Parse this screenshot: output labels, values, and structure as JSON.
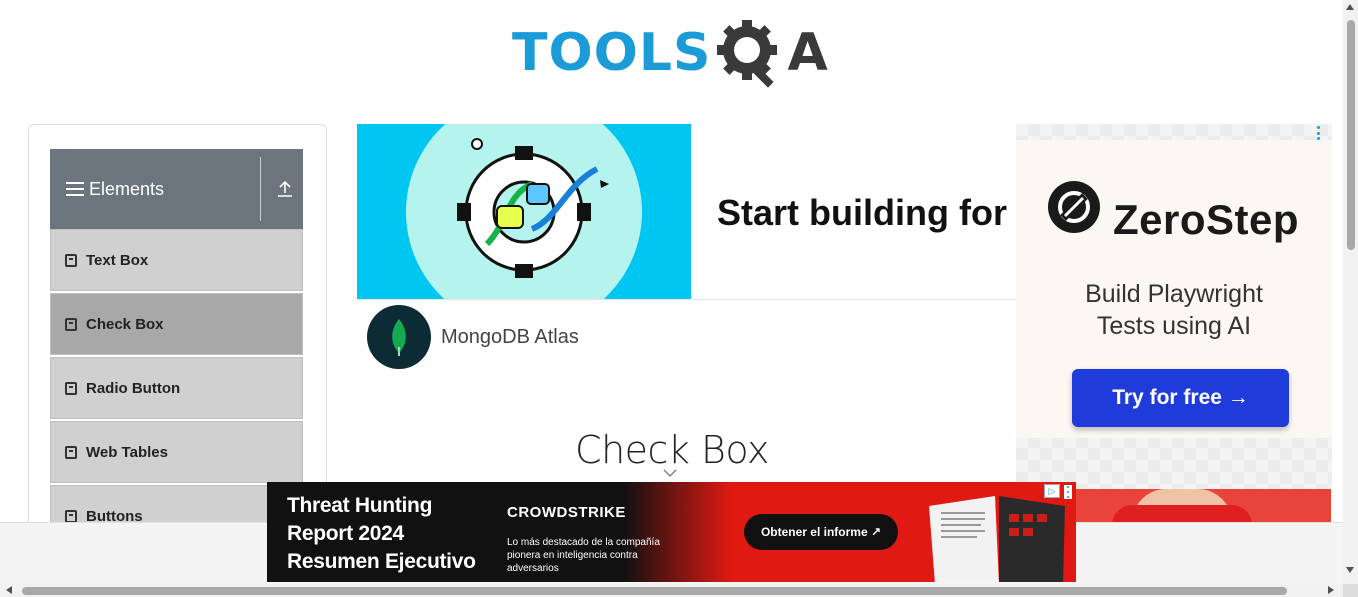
{
  "header": {
    "logo_text_left": "TOOLS",
    "logo_text_right": "A",
    "logo_icon": "gear-magnifier-icon",
    "colors": {
      "logo_blue": "#1b9cd8",
      "logo_dark": "#3a3a3a"
    }
  },
  "sidebar": {
    "group_title": "Elements",
    "group_icon": "hamburger-icon",
    "collapse_icon": "upload-arrow-icon",
    "items": [
      {
        "label": "Text Box",
        "icon": "html5-icon",
        "active": false
      },
      {
        "label": "Check Box",
        "icon": "html5-icon",
        "active": true
      },
      {
        "label": "Radio Button",
        "icon": "html5-icon",
        "active": false
      },
      {
        "label": "Web Tables",
        "icon": "html5-icon",
        "active": false
      },
      {
        "label": "Buttons",
        "icon": "html5-icon",
        "active": false
      }
    ],
    "colors": {
      "header_bg": "#6c757d",
      "item_bg": "#d0d0d0",
      "item_active_bg": "#a8a8a8"
    }
  },
  "main": {
    "page_title": "Check Box"
  },
  "ads": {
    "mongo": {
      "headline": "Start building for fr",
      "advertiser": "MongoDB Atlas"
    },
    "zerostep": {
      "brand": "ZeroStep",
      "tagline_line1": "Build Playwright",
      "tagline_line2": "Tests using AI",
      "cta": "Try for free →",
      "colors": {
        "cta_bg": "#1f3bd9"
      }
    },
    "crowdstrike": {
      "title_line1": "Threat Hunting",
      "title_line2": "Report 2024",
      "title_line3": "Resumen Ejecutivo",
      "brand": "CROWDSTRIKE",
      "description": "Lo más destacado de la compañía pionera en inteligencia contra adversarios",
      "cta": "Obtener el informe ↗",
      "colors": {
        "bg": "#e01a12"
      }
    }
  }
}
